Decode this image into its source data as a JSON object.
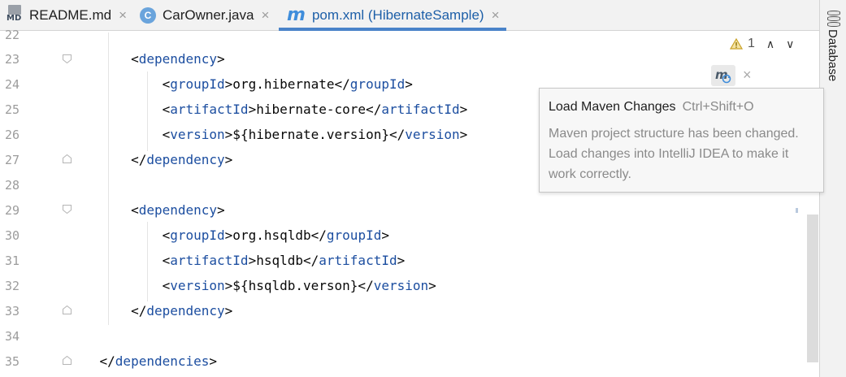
{
  "tabs": [
    {
      "label": "README.md",
      "icon": "markdown-file-icon",
      "icon_text": "MD",
      "active": false
    },
    {
      "label": "CarOwner.java",
      "icon": "java-class-icon",
      "icon_text": "C",
      "active": false
    },
    {
      "label": "pom.xml (HibernateSample)",
      "icon": "maven-pom-icon",
      "icon_text": "m",
      "active": true
    }
  ],
  "tab_close_glyph": "×",
  "side_panel": {
    "label": "Database",
    "icon": "database-icon"
  },
  "inspection": {
    "warning_count": "1",
    "up_glyph": "∧",
    "down_glyph": "∨"
  },
  "maven_popup": {
    "close_glyph": "×"
  },
  "tooltip": {
    "title": "Load Maven Changes",
    "shortcut": "Ctrl+Shift+O",
    "body": "Maven project structure has been changed. Load changes into IntelliJ IDEA to make it work correctly."
  },
  "editor": {
    "lines": [
      {
        "no": "22",
        "pre": "",
        "tag": "",
        "text": "",
        "close": "",
        "post": ""
      },
      {
        "no": "23",
        "pre": "        <",
        "tag": "dependency",
        "text": "",
        "close": "",
        "post": ">"
      },
      {
        "no": "24",
        "pre": "            <",
        "tag": "groupId",
        "text": ">org.hibernate</",
        "close": "groupId",
        "post": ">"
      },
      {
        "no": "25",
        "pre": "            <",
        "tag": "artifactId",
        "text": ">hibernate-core</",
        "close": "artifactId",
        "post": ">"
      },
      {
        "no": "26",
        "pre": "            <",
        "tag": "version",
        "text": ">${hibernate.version}</",
        "close": "version",
        "post": ">"
      },
      {
        "no": "27",
        "pre": "        </",
        "tag": "dependency",
        "text": "",
        "close": "",
        "post": ">"
      },
      {
        "no": "28",
        "pre": "",
        "tag": "",
        "text": "",
        "close": "",
        "post": ""
      },
      {
        "no": "29",
        "pre": "        <",
        "tag": "dependency",
        "text": "",
        "close": "",
        "post": ">"
      },
      {
        "no": "30",
        "pre": "            <",
        "tag": "groupId",
        "text": ">org.hsqldb</",
        "close": "groupId",
        "post": ">"
      },
      {
        "no": "31",
        "pre": "            <",
        "tag": "artifactId",
        "text": ">hsqldb</",
        "close": "artifactId",
        "post": ">"
      },
      {
        "no": "32",
        "pre": "            <",
        "tag": "version",
        "text": ">${hsqldb.verson}</",
        "close": "version",
        "post": ">"
      },
      {
        "no": "33",
        "pre": "        </",
        "tag": "dependency",
        "text": "",
        "close": "",
        "post": ">"
      },
      {
        "no": "34",
        "pre": "",
        "tag": "",
        "text": "",
        "close": "",
        "post": ""
      },
      {
        "no": "35",
        "pre": "    </",
        "tag": "dependencies",
        "text": "",
        "close": "",
        "post": ">"
      }
    ]
  },
  "colors": {
    "tag": "#1c4ea0",
    "active_tab_underline": "#4a83c9",
    "warning": "#c9a227"
  }
}
